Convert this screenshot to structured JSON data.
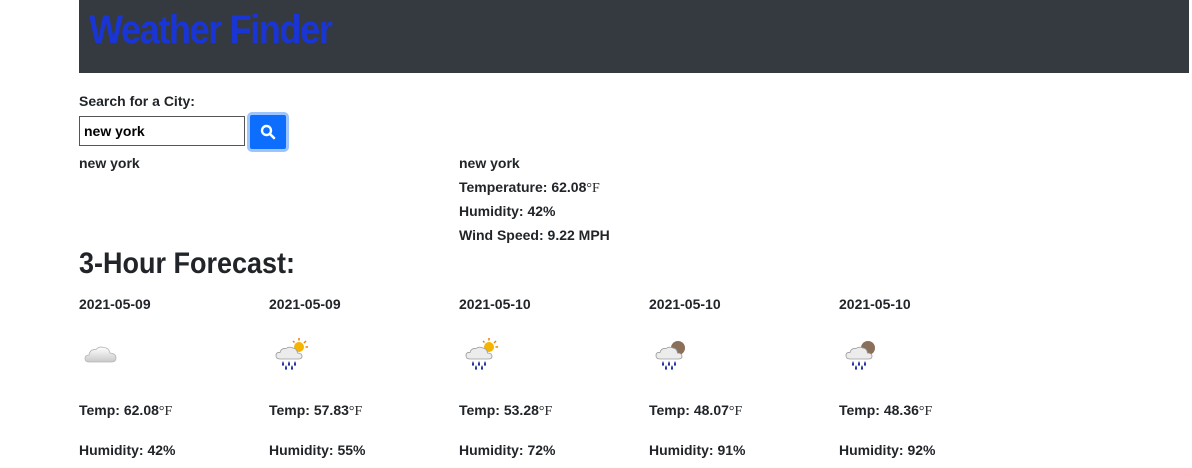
{
  "header": {
    "title": "Weather Finder"
  },
  "search": {
    "label": "Search for a City:",
    "value": "new york",
    "button_icon": "search-icon"
  },
  "searched_city": "new york",
  "current": {
    "city": "new york",
    "temperature_label": "Temperature: 62.08",
    "humidity_label": "Humidity: 42%",
    "wind_label": "Wind Speed: 9.22 MPH"
  },
  "forecast": {
    "heading": "3-Hour Forecast:",
    "unit": "°F",
    "items": [
      {
        "date": "2021-05-09",
        "icon": "cloud-icon",
        "temp": "Temp: 62.08",
        "humidity": "Humidity: 42%"
      },
      {
        "date": "2021-05-09",
        "icon": "rain-sun-icon",
        "temp": "Temp: 57.83",
        "humidity": "Humidity: 55%"
      },
      {
        "date": "2021-05-10",
        "icon": "rain-sun-icon",
        "temp": "Temp: 53.28",
        "humidity": "Humidity: 72%"
      },
      {
        "date": "2021-05-10",
        "icon": "rain-moon-icon",
        "temp": "Temp: 48.07",
        "humidity": "Humidity: 91%"
      },
      {
        "date": "2021-05-10",
        "icon": "rain-moon-icon",
        "temp": "Temp: 48.36",
        "humidity": "Humidity: 92%"
      }
    ]
  },
  "colors": {
    "header_bg": "#343a40",
    "title": "#1a35d6",
    "button": "#0d6efd"
  }
}
